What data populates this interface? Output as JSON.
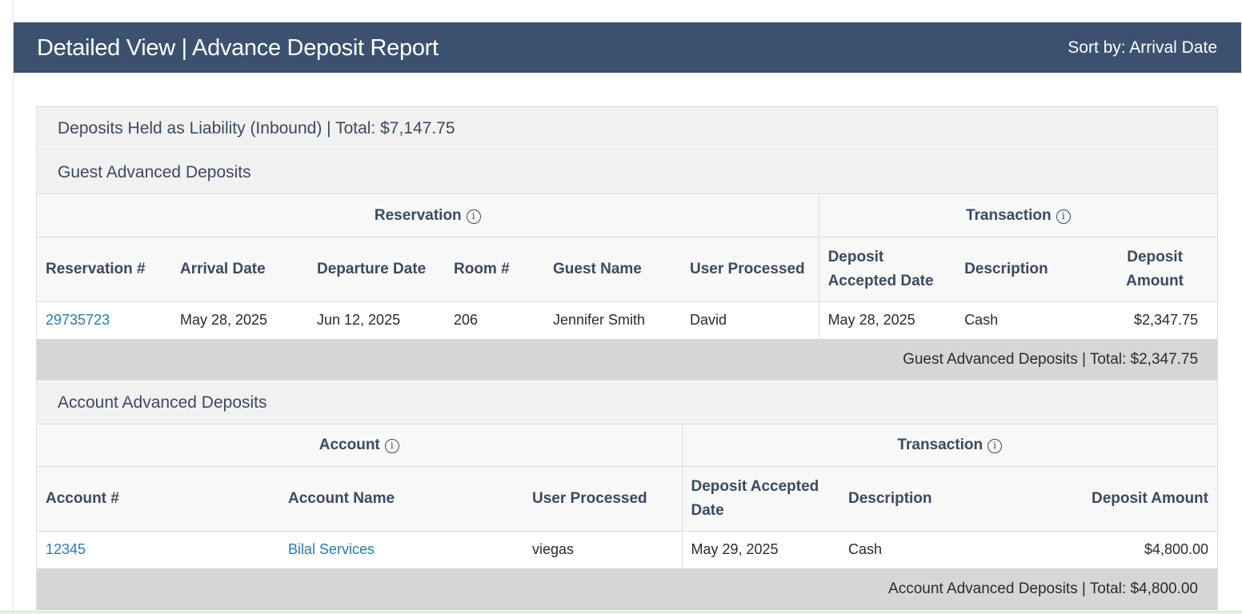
{
  "header": {
    "title": "Detailed View | Advance Deposit Report",
    "sort_label": "Sort by: Arrival Date"
  },
  "liability": {
    "title": "Deposits Held as Liability (Inbound) | Total: $7,147.75"
  },
  "guest": {
    "section_title": "Guest Advanced Deposits",
    "group_reservation": "Reservation",
    "group_transaction": "Transaction",
    "columns": [
      "Reservation #",
      "Arrival Date",
      "Departure Date",
      "Room #",
      "Guest Name",
      "User Processed",
      "Deposit Accepted Date",
      "Description",
      "Deposit Amount"
    ],
    "rows": [
      {
        "reservation": "29735723",
        "arrival": "May 28, 2025",
        "departure": "Jun 12, 2025",
        "room": "206",
        "guest_name": "Jennifer Smith",
        "user": "David",
        "accepted": "May 28, 2025",
        "description": "Cash",
        "amount": "$2,347.75"
      }
    ],
    "total": "Guest Advanced Deposits | Total: $2,347.75"
  },
  "account": {
    "section_title": "Account Advanced Deposits",
    "group_account": "Account",
    "group_transaction": "Transaction",
    "columns": [
      "Account #",
      "Account Name",
      "User Processed",
      "Deposit Accepted Date",
      "Description",
      "Deposit Amount"
    ],
    "rows": [
      {
        "account": "12345",
        "account_name": "Bilal Services",
        "user": "viegas",
        "accepted": "May 29, 2025",
        "description": "Cash",
        "amount": "$4,800.00"
      }
    ],
    "total": "Account Advanced Deposits | Total: $4,800.00"
  },
  "icons": {
    "info": "info-icon"
  },
  "colors": {
    "header_bg": "#3b5170",
    "link": "#2a7ab8",
    "total_bg": "#d6d6d6"
  }
}
